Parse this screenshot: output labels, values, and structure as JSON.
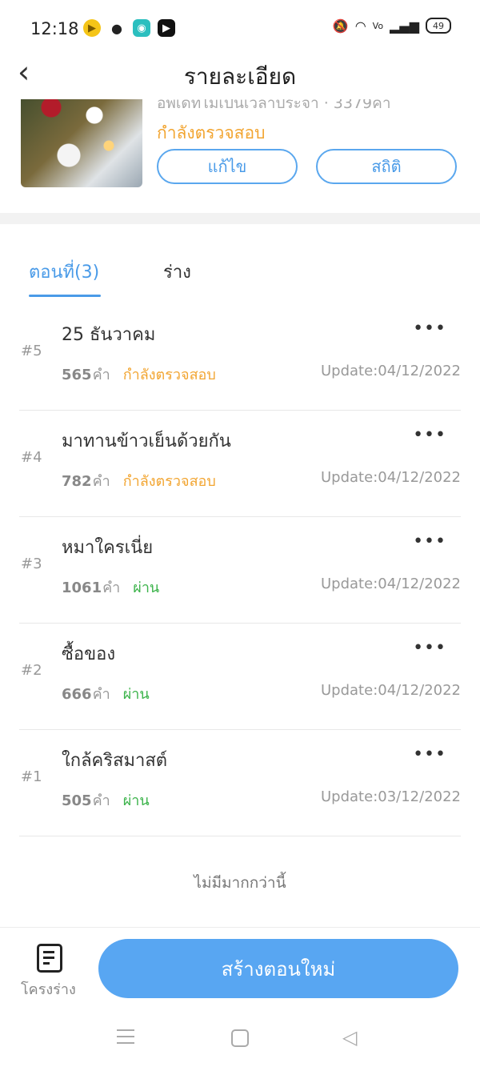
{
  "status_bar": {
    "time": "12:18",
    "battery": "49",
    "app_icons": [
      "yellow-play-icon",
      "mask-icon",
      "chat-icon",
      "video-icon"
    ],
    "icons": [
      "mute-icon",
      "wifi-icon",
      "volte-icon",
      "signal-icon",
      "battery-icon"
    ]
  },
  "header": {
    "title": "รายละเอียด",
    "back_icon": "chevron-left-icon"
  },
  "book": {
    "subtitle": "อัพเดทไม่เป็นเวลาประจำ · 3379คำ",
    "status": "กำลังตรวจสอบ",
    "edit_label": "แก้ไข",
    "stats_label": "สถิติ",
    "colors": {
      "pending": "#f2a531",
      "accent": "#4a9be8"
    }
  },
  "tabs": {
    "episodes_label": "ตอนที่(3)",
    "draft_label": "ร่าง"
  },
  "episodes": [
    {
      "num": "#5",
      "title": "25 ธันวาคม",
      "words": "565",
      "unit": "คำ",
      "status": "กำลังตรวจสอบ",
      "status_type": "pending",
      "update": "Update:04/12/2022"
    },
    {
      "num": "#4",
      "title": "มาทานข้าวเย็นด้วยกัน",
      "words": "782",
      "unit": "คำ",
      "status": "กำลังตรวจสอบ",
      "status_type": "pending",
      "update": "Update:04/12/2022"
    },
    {
      "num": "#3",
      "title": "หมาใครเนี่ย",
      "words": "1061",
      "unit": "คำ",
      "status": "ผ่าน",
      "status_type": "pass",
      "update": "Update:04/12/2022"
    },
    {
      "num": "#2",
      "title": "ซื้อของ",
      "words": "666",
      "unit": "คำ",
      "status": "ผ่าน",
      "status_type": "pass",
      "update": "Update:04/12/2022"
    },
    {
      "num": "#1",
      "title": "ใกล้คริสมาสต์",
      "words": "505",
      "unit": "คำ",
      "status": "ผ่าน",
      "status_type": "pass",
      "update": "Update:03/12/2022"
    }
  ],
  "list_end_text": "ไม่มีมากกว่านี้",
  "bottom_bar": {
    "draft_label": "โครงร่าง",
    "create_label": "สร้างตอนใหม่",
    "more_glyph": "•••"
  }
}
